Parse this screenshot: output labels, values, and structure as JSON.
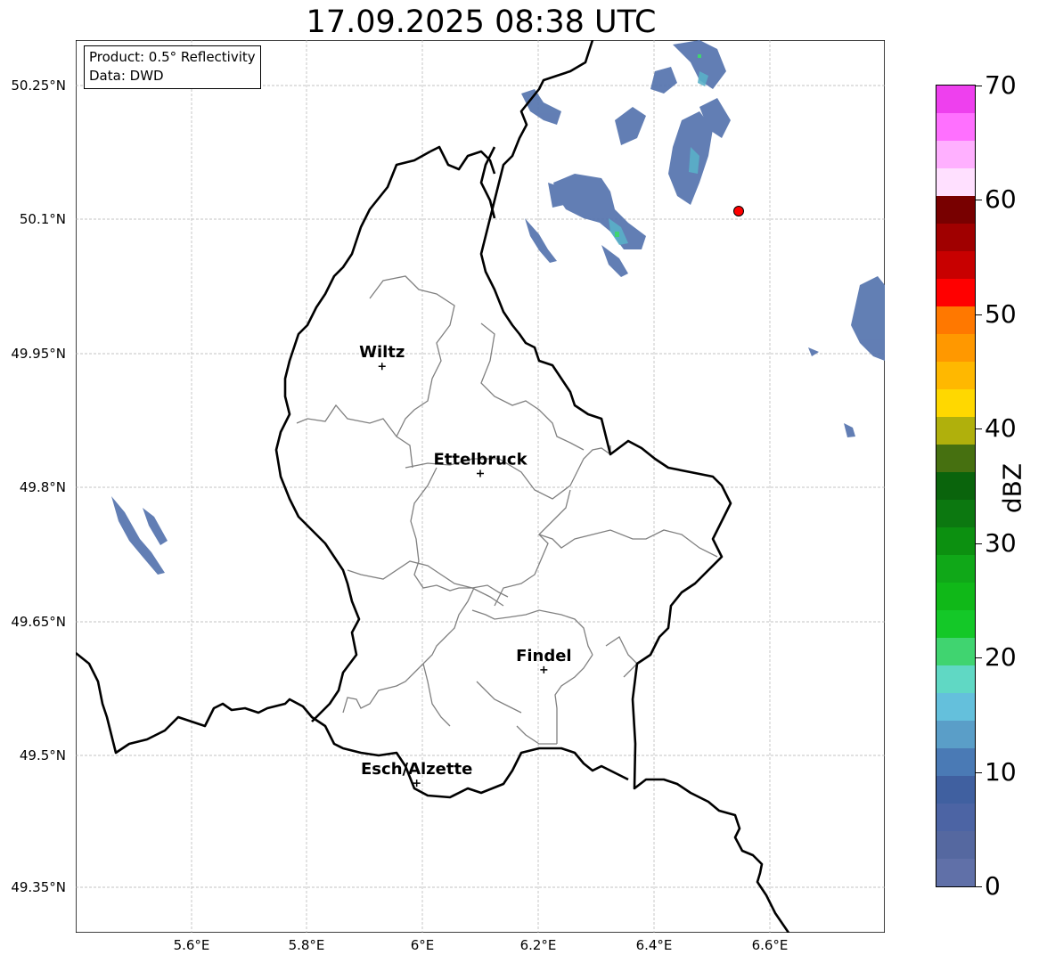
{
  "title": "17.09.2025 08:38 UTC",
  "info_box": {
    "line1": "Product: 0.5° Reflectivity",
    "line2": "Data: DWD"
  },
  "axes": {
    "y_ticks": [
      "50.25°N",
      "50.1°N",
      "49.95°N",
      "49.8°N",
      "49.65°N",
      "49.5°N",
      "49.35°N"
    ],
    "x_ticks": [
      "5.6°E",
      "5.8°E",
      "6°E",
      "6.2°E",
      "6.4°E",
      "6.6°E"
    ]
  },
  "cities": [
    {
      "name": "Wiltz",
      "lon": 5.93,
      "lat": 49.967
    },
    {
      "name": "Ettelbruck",
      "lon": 6.1,
      "lat": 49.847
    },
    {
      "name": "Findel",
      "lon": 6.21,
      "lat": 49.627
    },
    {
      "name": "Esch/Alzette",
      "lon": 5.99,
      "lat": 49.5
    }
  ],
  "radar_marker": {
    "lon": 6.548,
    "lat": 50.11,
    "color": "#ff0000"
  },
  "colorbar": {
    "label": "dBZ",
    "ticks": [
      "0",
      "10",
      "20",
      "30",
      "40",
      "50",
      "60",
      "70"
    ],
    "colors": [
      "#6070a8",
      "#5568a0",
      "#4c64a4",
      "#4060a0",
      "#4a7ab5",
      "#5a9ec8",
      "#64c0dc",
      "#60d8c4",
      "#40d470",
      "#14c828",
      "#10b818",
      "#10a818",
      "#0c9010",
      "#0c7810",
      "#0a640c",
      "#467010",
      "#b0b00c",
      "#ffd800",
      "#ffb800",
      "#ff9800",
      "#ff7800",
      "#ff0000",
      "#c80000",
      "#a00000",
      "#780000",
      "#ffe0ff",
      "#ffb0ff",
      "#ff70ff",
      "#ee40ee"
    ]
  }
}
